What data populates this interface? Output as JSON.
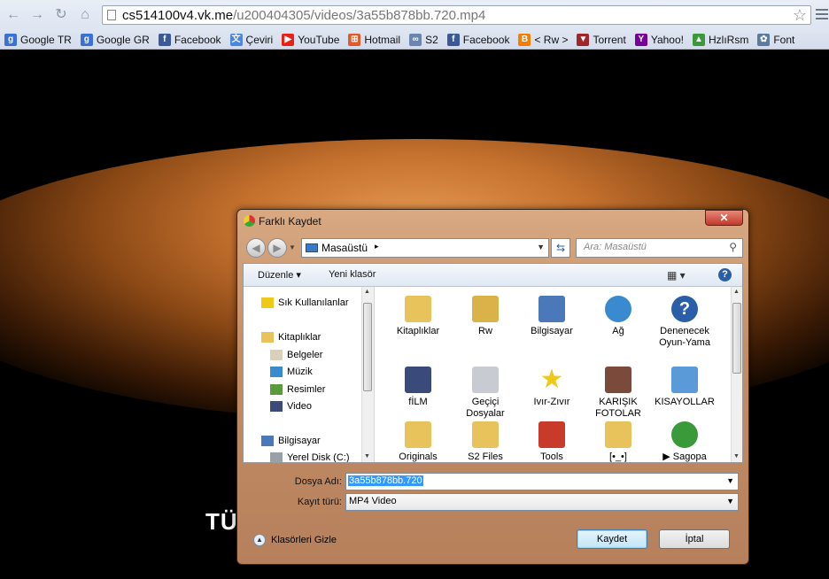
{
  "browser": {
    "url_host": "cs514100v4.vk.me",
    "url_path": "/u200404305/videos/3a55b878bb.720.mp4",
    "bookmarks": [
      {
        "label": "Google TR",
        "icon": "google-icon",
        "color": "#3a70d8"
      },
      {
        "label": "Google GR",
        "icon": "google-icon",
        "color": "#3a70d8"
      },
      {
        "label": "Facebook",
        "icon": "facebook-icon",
        "color": "#3b5998"
      },
      {
        "label": "Çeviri",
        "icon": "translate-icon",
        "color": "#4a86e8"
      },
      {
        "label": "YouTube",
        "icon": "youtube-icon",
        "color": "#e62117"
      },
      {
        "label": "Hotmail",
        "icon": "windows-icon",
        "color": "#e05a2a"
      },
      {
        "label": "S2",
        "icon": "s2-icon",
        "color": "#6a86b0"
      },
      {
        "label": "Facebook",
        "icon": "facebook-icon",
        "color": "#3b5998"
      },
      {
        "label": "< Rw >",
        "icon": "blogger-icon",
        "color": "#f57d00"
      },
      {
        "label": "Torrent",
        "icon": "torrent-icon",
        "color": "#a0262a"
      },
      {
        "label": "Yahoo!",
        "icon": "yahoo-icon",
        "color": "#7b0099"
      },
      {
        "label": "HzlıRsm",
        "icon": "hzlirsm-icon",
        "color": "#3a9a3a"
      },
      {
        "label": "Font",
        "icon": "font-icon",
        "color": "#5a7aa0"
      }
    ]
  },
  "video": {
    "caption": "TÜ"
  },
  "dialog": {
    "title": "Farklı Kaydet",
    "close_symbol": "✕",
    "location": "Masaüstü",
    "search_placeholder": "Ara: Masaüstü",
    "organize_label": "Düzenle ▾",
    "new_folder_label": "Yeni klasör",
    "tree": [
      {
        "label": "Sık Kullanılanlar",
        "icon": "star-icon"
      },
      {
        "label": "Kitaplıklar",
        "icon": "libraries-icon"
      },
      {
        "label": "Belgeler",
        "icon": "documents-icon"
      },
      {
        "label": "Müzik",
        "icon": "music-icon"
      },
      {
        "label": "Resimler",
        "icon": "pictures-icon"
      },
      {
        "label": "Video",
        "icon": "video-icon"
      },
      {
        "label": "Bilgisayar",
        "icon": "computer-icon"
      },
      {
        "label": "Yerel Disk (C:)",
        "icon": "disk-icon"
      }
    ],
    "files": [
      {
        "label": "Kitaplıklar",
        "icon": "libraries-icon",
        "color": "#e8c25a"
      },
      {
        "label": "Rw",
        "icon": "user-folder-icon",
        "color": "#d9b24a"
      },
      {
        "label": "Bilgisayar",
        "icon": "computer-icon",
        "color": "#4a78b8"
      },
      {
        "label": "Ağ",
        "icon": "network-icon",
        "color": "#3a8ad0"
      },
      {
        "label": "Denenecek Oyun-Yama",
        "icon": "help-icon",
        "color": "#2a5ea8"
      },
      {
        "label": "fİLM",
        "icon": "film-folder-icon",
        "color": "#3a4a7a"
      },
      {
        "label": "Geçiçi Dosyalar",
        "icon": "clock-icon",
        "color": "#c8ccd2"
      },
      {
        "label": "Ivır-Zıvır",
        "icon": "star-icon",
        "color": "#f0c818"
      },
      {
        "label": "KARIŞIK FOTOLAR",
        "icon": "film-folder-icon",
        "color": "#7a4a3a"
      },
      {
        "label": "KISAYOLLAR",
        "icon": "shortcuts-icon",
        "color": "#5a9ad8"
      },
      {
        "label": "Originals",
        "icon": "folder-icon",
        "color": "#e8c25a"
      },
      {
        "label": "S2 Files",
        "icon": "folder-icon",
        "color": "#e8c25a"
      },
      {
        "label": "Tools",
        "icon": "tools-icon",
        "color": "#c83a2a"
      },
      {
        "label": "[•_•]",
        "icon": "lock-folder-icon",
        "color": "#e8c25a"
      },
      {
        "label": "▶ Sagopa",
        "icon": "chrome-icon",
        "color": "#3a9a3a"
      }
    ],
    "filename_label": "Dosya Adı:",
    "filename_value": "3a55b878bb.720",
    "filetype_label": "Kayıt türü:",
    "filetype_value": "MP4 Video",
    "hide_folders_label": "Klasörleri Gizle",
    "save_label": "Kaydet",
    "cancel_label": "İptal"
  }
}
